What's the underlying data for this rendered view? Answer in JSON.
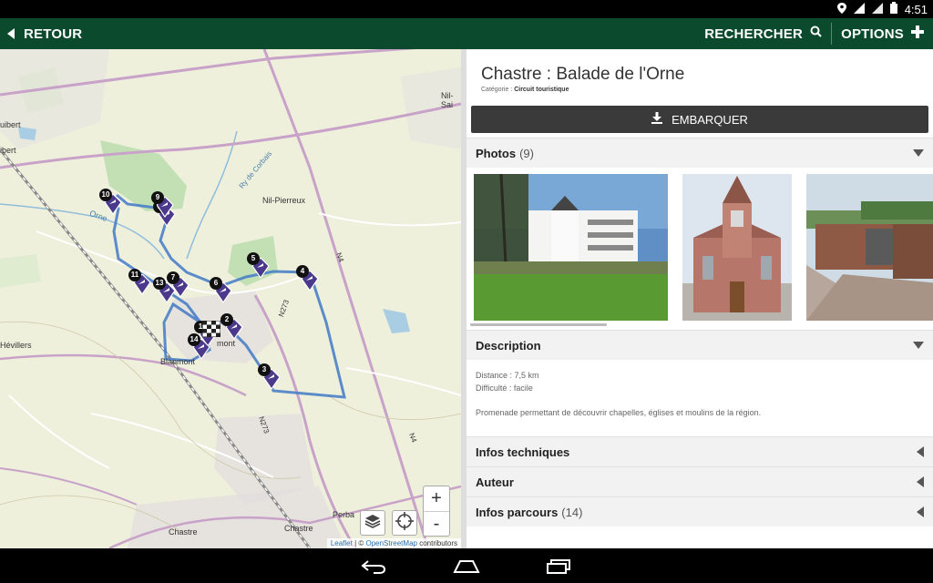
{
  "status_bar": {
    "time": "4:51",
    "icons": [
      "location-icon",
      "signal-3g-icon",
      "signal-bars-icon",
      "battery-icon"
    ]
  },
  "action_bar": {
    "back_label": "RETOUR",
    "search_label": "RECHERCHER",
    "options_label": "OPTIONS",
    "background_color": "#0b4a2c"
  },
  "map": {
    "labels": {
      "nil_sai": "Nil-Sai",
      "uibert1": "uibert",
      "uibert2": "ibert",
      "nil_pierreux": "Nil-Pierreux",
      "ry_corbais": "Ry de Corbais",
      "orne": "Orne",
      "hevillers": "Hévillers",
      "blanmont": "Blanmont",
      "mont": "mont",
      "perba": "Perba",
      "chastre1": "Chastre",
      "chastre2": "Chastre",
      "n273_a": "N273",
      "n273_b": "N273",
      "n4_a": "N4",
      "n4_b": "N4"
    },
    "markers": [
      "1",
      "2",
      "3",
      "4",
      "5",
      "6",
      "7",
      "8",
      "9",
      "10",
      "11",
      "13",
      "14"
    ],
    "route_color": "#4a7fc7",
    "zoom_in": "+",
    "zoom_out": "-",
    "attribution": {
      "leaflet": "Leaflet",
      "sep": " | © ",
      "osm": "OpenStreetMap",
      "contributors": " contributors"
    }
  },
  "detail": {
    "title": "Chastre : Balade de l'Orne",
    "category_label": "Catégorie : ",
    "category_value": "Circuit touristique",
    "embark_label": "EMBARQUER",
    "photos": {
      "label": "Photos",
      "count": "(9)"
    },
    "description": {
      "label": "Description",
      "distance": "Distance : 7,5 km",
      "difficulty": "Difficulté : facile",
      "text": "Promenade permettant de découvrir chapelles, églises et moulins de la région."
    },
    "sections": [
      {
        "label": "Infos techniques",
        "count": ""
      },
      {
        "label": "Auteur",
        "count": ""
      },
      {
        "label": "Infos parcours",
        "count": "(14)"
      }
    ]
  }
}
